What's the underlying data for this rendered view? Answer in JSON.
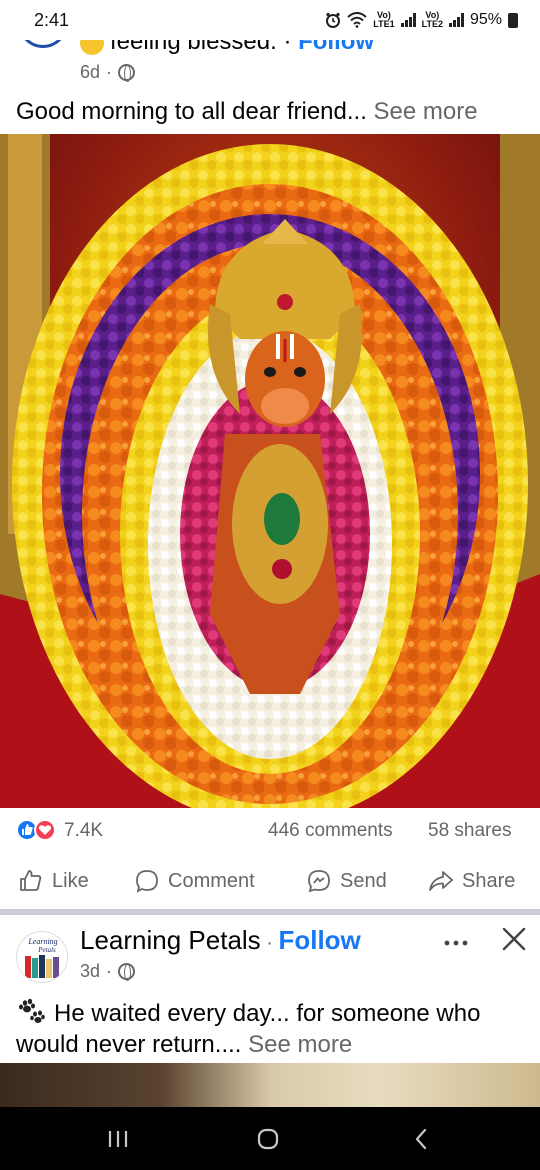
{
  "status_bar": {
    "time": "2:41",
    "net1_top": "Vo)",
    "net1_bottom": "LTE1",
    "net2_top": "Vo)",
    "net2_bottom": "LTE2",
    "battery": "95%",
    "icons": [
      "alarm-icon",
      "wifi-icon",
      "signal-icon",
      "battery-icon"
    ]
  },
  "post1": {
    "feeling_text": "feeling blessed.",
    "follow_label": "Follow",
    "time_ago": "6d",
    "privacy_icon": "globe-icon",
    "text": "Good morning to all dear friend...",
    "see_more": "See more",
    "image_icon": "hanuman-idol-photo",
    "reactions_count": "7.4K",
    "comments_count": "446 comments",
    "shares_count": "58 shares",
    "actions": {
      "like": "Like",
      "comment": "Comment",
      "send": "Send",
      "share": "Share"
    }
  },
  "post2": {
    "page_name": "Learning Petals",
    "avatar_text_1": "Learning",
    "avatar_text_2": "Petals",
    "follow_label": "Follow",
    "time_ago": "3d",
    "text": "He waited every day... for someone who would never return....",
    "see_more": "See more"
  },
  "colors": {
    "accent": "#1877f2",
    "love": "#f33e58",
    "secondary_text": "#65676b"
  }
}
